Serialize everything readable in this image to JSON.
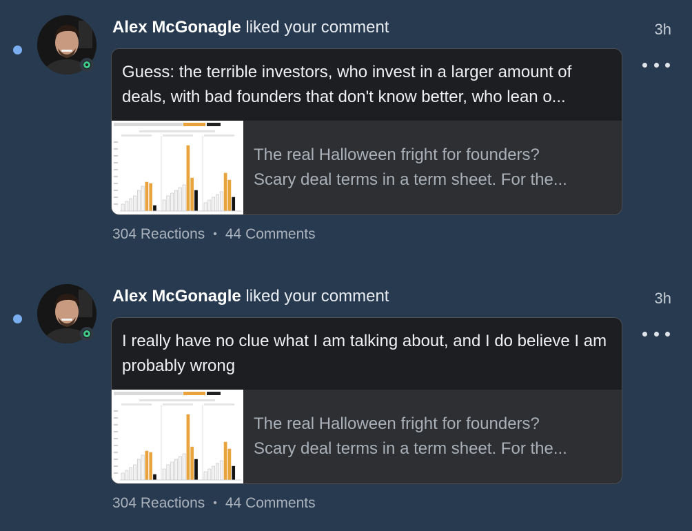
{
  "notifications": [
    {
      "actor": "Alex McGonagle",
      "action": " liked your comment",
      "time": "3h",
      "comment": "Guess: the terrible investors, who invest in a larger amount of deals, with bad founders that don't know better, who lean o...",
      "post_line1": "The real Halloween fright for founders?",
      "post_line2": "Scary deal terms in a term sheet. For the...",
      "reactions": "304 Reactions",
      "separator": "•",
      "comments": "44 Comments",
      "unread": true
    },
    {
      "actor": "Alex McGonagle",
      "action": " liked your comment",
      "time": "3h",
      "comment": "I really have no clue what I am talking about, and I do believe I am probably wrong",
      "post_line1": "The real Halloween fright for founders?",
      "post_line2": "Scary deal terms in a term sheet. For the...",
      "reactions": "304 Reactions",
      "separator": "•",
      "comments": "44 Comments",
      "unread": true
    }
  ],
  "icons": {
    "unread": "unread-dot-icon",
    "presence": "online-status-icon",
    "more": "more-options-icon"
  },
  "colors": {
    "background": "#283a50",
    "unread_dot": "#7aaef0",
    "presence_ring": "#41c88a",
    "bar_highlight": "#e8a33d"
  }
}
